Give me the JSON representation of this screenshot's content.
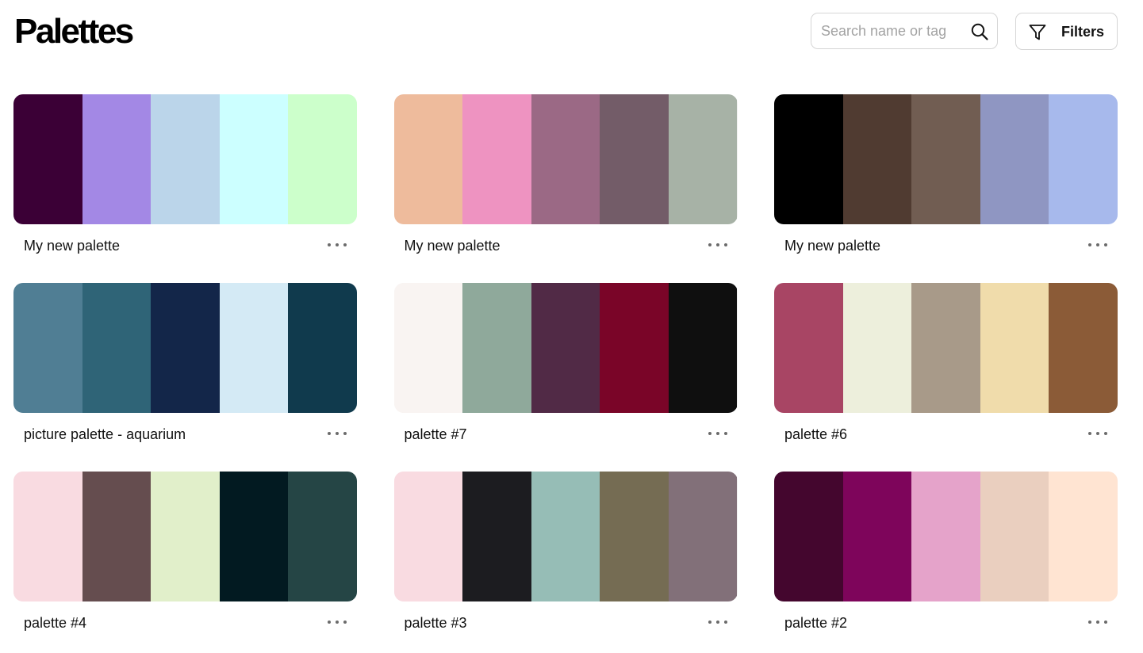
{
  "header": {
    "title": "Palettes",
    "search": {
      "placeholder": "Search name or tag",
      "value": "",
      "icon": "search-icon"
    },
    "filters": {
      "label": "Filters",
      "icon": "filter-icon"
    }
  },
  "palettes": [
    {
      "name": "My new palette",
      "colors": [
        "#3b0036",
        "#a388e5",
        "#bbd5ea",
        "#ccffff",
        "#ccffcb"
      ]
    },
    {
      "name": "My new palette",
      "colors": [
        "#eebb9c",
        "#ee93c1",
        "#9b6985",
        "#735c68",
        "#a7b2a6"
      ]
    },
    {
      "name": "My new palette",
      "colors": [
        "#000000",
        "#503b31",
        "#715d52",
        "#8f96c2",
        "#a7b9ec"
      ]
    },
    {
      "name": "picture palette - aquarium",
      "colors": [
        "#507e94",
        "#2f6477",
        "#132649",
        "#d4eaf5",
        "#103a4d"
      ]
    },
    {
      "name": "palette #7",
      "colors": [
        "#f9f4f2",
        "#8fa99b",
        "#512a46",
        "#7a0528",
        "#0f0f0f"
      ]
    },
    {
      "name": "palette #6",
      "colors": [
        "#a84564",
        "#edefdc",
        "#a89a89",
        "#f0dcab",
        "#8b5b37"
      ]
    },
    {
      "name": "palette #4",
      "colors": [
        "#f9dbe1",
        "#654d4f",
        "#e1efca",
        "#021a21",
        "#254545"
      ]
    },
    {
      "name": "palette #3",
      "colors": [
        "#f9dbe1",
        "#1c1c20",
        "#96bdb6",
        "#756c53",
        "#827079"
      ]
    },
    {
      "name": "palette #2",
      "colors": [
        "#44062e",
        "#7e055b",
        "#e5a3ca",
        "#eacfbf",
        "#ffe4d2"
      ]
    }
  ],
  "more_icon": "more-horizontal-icon"
}
